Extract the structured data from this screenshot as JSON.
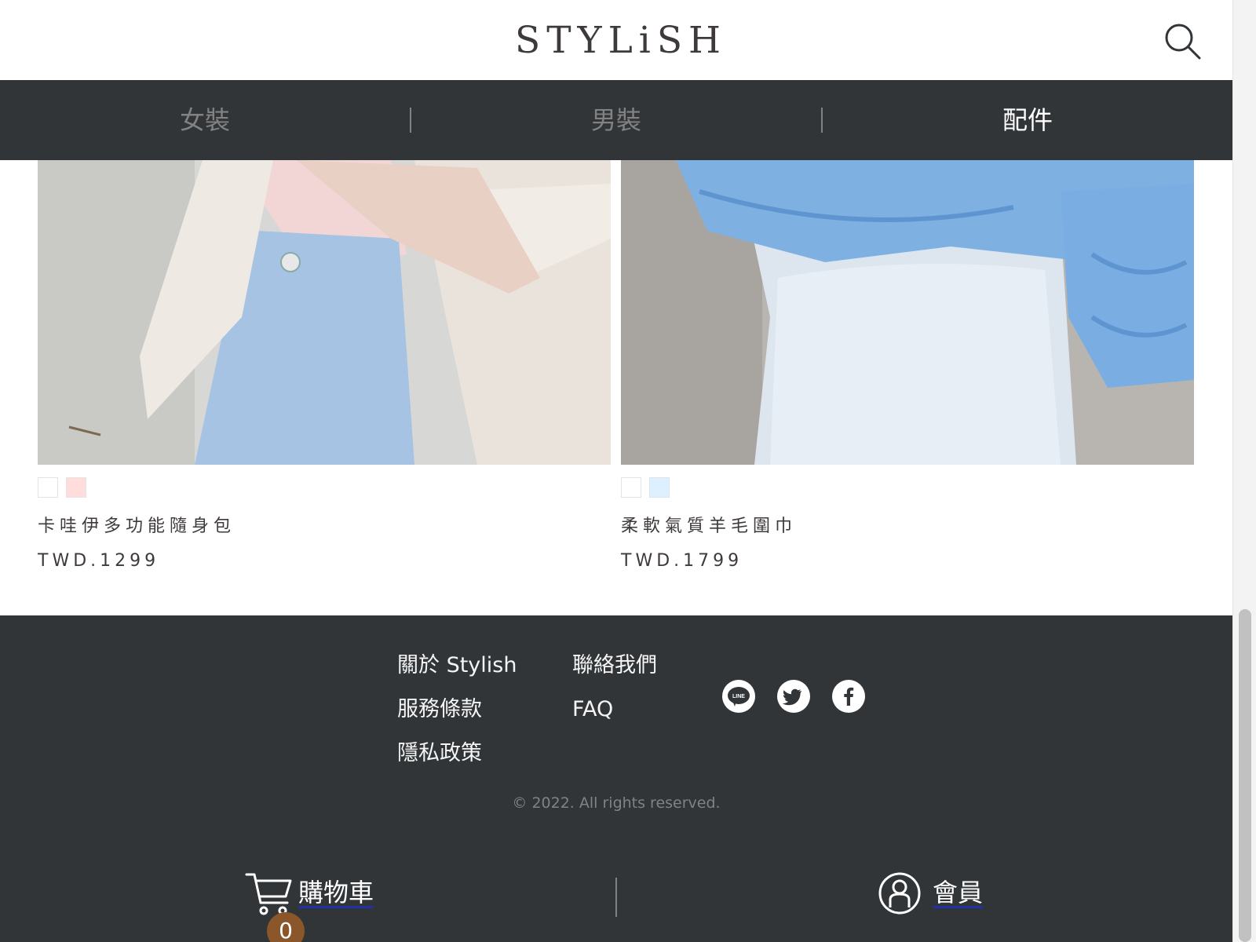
{
  "header": {
    "logo": "STYLiSH",
    "search_icon": "search-icon"
  },
  "categories": [
    {
      "label": "女裝",
      "active": false
    },
    {
      "label": "男裝",
      "active": false
    },
    {
      "label": "配件",
      "active": true
    }
  ],
  "products": [
    {
      "name": "卡哇伊多功能隨身包",
      "price": "TWD.1299",
      "colors": [
        "#FFFFFF",
        "#FFDDDD"
      ]
    },
    {
      "name": "柔軟氣質羊毛圍巾",
      "price": "TWD.1799",
      "colors": [
        "#FFFFFF",
        "#DDF0FF"
      ]
    }
  ],
  "footer": {
    "col1": [
      "關於 Stylish",
      "服務條款",
      "隱私政策"
    ],
    "col2": [
      "聯絡我們",
      "FAQ"
    ],
    "socials": [
      "line-icon",
      "twitter-icon",
      "facebook-icon"
    ],
    "copyright": "© 2022. All rights reserved."
  },
  "bottom_bar": {
    "cart_label": "購物車",
    "cart_count": "0",
    "member_label": "會員"
  },
  "colors": {
    "dark": "#313538",
    "badge": "#8B572A",
    "muted": "#828282"
  }
}
